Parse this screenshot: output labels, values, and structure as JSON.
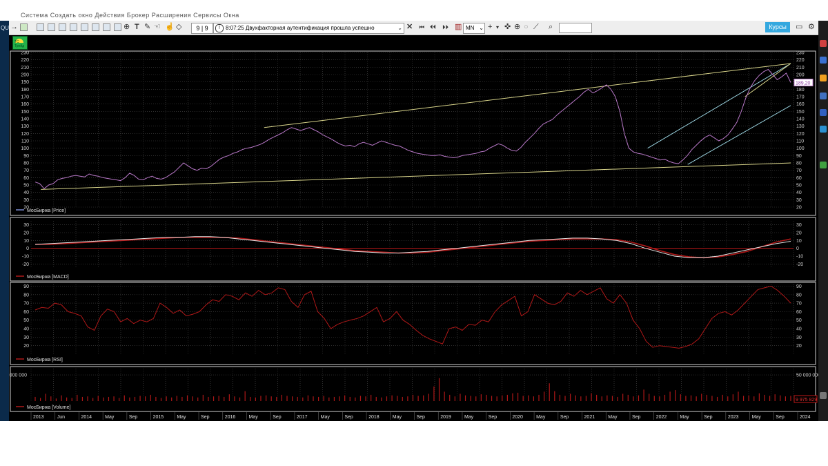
{
  "window": {
    "app_label": "QU",
    "menu_fragment": "Система   Создать окно   Действия   Брокер   Расширения   Сервисы   Окна"
  },
  "toolbar": {
    "counter": "9 | 9",
    "message": "8:07:25  Двухфакторная аутентификация прошла успешно",
    "period": "MN",
    "search_value": "",
    "kursy_label": "Курсы",
    "icons": [
      "arrow-right-icon",
      "chart-new-icon",
      "table-icon",
      "quotes-icon",
      "orders-icon",
      "deals-icon",
      "portfolio-icon",
      "positions-icon",
      "alerts-icon",
      "news-icon",
      "info-icon",
      "text-tool-icon",
      "pencil-icon",
      "hand-icon",
      "pointer-icon",
      "clear-icon",
      "close-icon",
      "first-icon",
      "prev-icon",
      "bars-icon",
      "plus-icon",
      "crosshair-icon",
      "target-icon",
      "ruler-icon",
      "magnifier-icon",
      "message-icon",
      "settings-icon"
    ]
  },
  "logo": {
    "text": "ТС Трейд"
  },
  "chart_data": [
    {
      "type": "line",
      "panel": "price",
      "legend": "МосБиржа [Price]",
      "last_value_label": "189,20",
      "ylim": [
        20,
        230
      ],
      "yticks": [
        20,
        30,
        40,
        50,
        60,
        70,
        80,
        90,
        100,
        110,
        120,
        130,
        140,
        150,
        160,
        170,
        180,
        190,
        200,
        210,
        220,
        230
      ],
      "x_start": "2013-02",
      "x_end": "2024-02",
      "color": "#b878c8",
      "series": [
        {
          "values": [
            54,
            52,
            45,
            50,
            52,
            57,
            59,
            60,
            62,
            63,
            62,
            61,
            65,
            63,
            62,
            60,
            59,
            58,
            57,
            56,
            60,
            66,
            63,
            58,
            57,
            60,
            62,
            59,
            58,
            60,
            64,
            68,
            74,
            80,
            76,
            72,
            70,
            73,
            72,
            75,
            80,
            85,
            88,
            90,
            93,
            95,
            98,
            100,
            101,
            103,
            105,
            108,
            112,
            115,
            118,
            121,
            125,
            128,
            126,
            124,
            126,
            128,
            125,
            122,
            118,
            115,
            112,
            108,
            105,
            103,
            104,
            102,
            106,
            108,
            106,
            104,
            107,
            110,
            108,
            106,
            104,
            103,
            100,
            97,
            95,
            93,
            92,
            91,
            90,
            90,
            91,
            89,
            88,
            87,
            88,
            90,
            91,
            92,
            93,
            95,
            96,
            100,
            103,
            106,
            104,
            100,
            97,
            96,
            101,
            108,
            114,
            120,
            127,
            133,
            136,
            139,
            145,
            150,
            155,
            160,
            165,
            170,
            176,
            180,
            175,
            178,
            182,
            186,
            180,
            170,
            150,
            120,
            100,
            95,
            93,
            92,
            90,
            88,
            86,
            84,
            85,
            82,
            80,
            79,
            84,
            90,
            98,
            104,
            110,
            115,
            118,
            114,
            110,
            113,
            118,
            126,
            135,
            150,
            168,
            182,
            192,
            199,
            204,
            207,
            200,
            193,
            197,
            202,
            189.2
          ]
        },
        {
          "name_hidden": true,
          "values": []
        }
      ],
      "trendlines": [
        {
          "color": "#d8d48a",
          "from": [
            "2013-03",
            44
          ],
          "to": [
            "2024-02",
            80
          ]
        },
        {
          "color": "#d8d48a",
          "from": [
            "2016-06",
            128
          ],
          "to": [
            "2024-02",
            215
          ]
        },
        {
          "color": "#9ad3e0",
          "from": [
            "2022-01",
            100
          ],
          "to": [
            "2024-02",
            215
          ]
        },
        {
          "color": "#9ad3e0",
          "from": [
            "2022-08",
            78
          ],
          "to": [
            "2024-02",
            158
          ]
        },
        {
          "color": "#d8d48a",
          "from": [
            "2023-06",
            170
          ],
          "to": [
            "2024-02",
            215
          ]
        }
      ]
    },
    {
      "type": "line",
      "panel": "macd",
      "legend": "МосБиржа [MACD]",
      "ylim": [
        -25,
        35
      ],
      "yticks": [
        -20,
        -10,
        0,
        10,
        20,
        30
      ],
      "series": [
        {
          "color": "#e6e6e6",
          "values": [
            5,
            6,
            7,
            8,
            9,
            10,
            11,
            12,
            13,
            14,
            14,
            15,
            15,
            14,
            12,
            10,
            8,
            6,
            4,
            2,
            0,
            -2,
            -4,
            -5,
            -6,
            -6,
            -5,
            -4,
            -2,
            0,
            2,
            4,
            6,
            8,
            10,
            11,
            12,
            13,
            13,
            12,
            10,
            6,
            0,
            -5,
            -10,
            -12,
            -12,
            -10,
            -6,
            -2,
            2,
            6,
            9
          ]
        },
        {
          "color": "#b01818",
          "values": [
            5,
            5,
            6,
            7,
            8,
            9,
            10,
            11,
            12,
            13,
            14,
            14,
            14,
            14,
            13,
            11,
            9,
            7,
            5,
            3,
            1,
            -1,
            -3,
            -4,
            -5,
            -6,
            -6,
            -5,
            -3,
            -1,
            1,
            3,
            5,
            7,
            9,
            10,
            11,
            12,
            12,
            12,
            11,
            8,
            3,
            -3,
            -8,
            -11,
            -12,
            -11,
            -8,
            -4,
            2,
            8,
            12
          ]
        }
      ],
      "zero_line_color": "#c01818"
    },
    {
      "type": "line",
      "panel": "rsi",
      "legend": "МосБиржа [RSI]",
      "ylim": [
        10,
        92
      ],
      "yticks": [
        20,
        30,
        40,
        50,
        60,
        70,
        80,
        90
      ],
      "color": "#b01818",
      "series": [
        {
          "values": [
            62,
            65,
            64,
            70,
            68,
            60,
            58,
            55,
            42,
            38,
            55,
            63,
            60,
            48,
            52,
            46,
            50,
            48,
            52,
            70,
            65,
            58,
            62,
            55,
            57,
            60,
            68,
            74,
            72,
            80,
            78,
            74,
            82,
            78,
            85,
            80,
            82,
            88,
            86,
            72,
            65,
            80,
            84,
            60,
            52,
            40,
            45,
            48,
            50,
            52,
            55,
            60,
            65,
            48,
            52,
            60,
            50,
            45,
            38,
            32,
            28,
            25,
            22,
            40,
            42,
            38,
            45,
            44,
            50,
            48,
            60,
            68,
            73,
            78,
            55,
            60,
            80,
            75,
            70,
            68,
            72,
            82,
            78,
            85,
            80,
            84,
            88,
            75,
            70,
            80,
            70,
            50,
            40,
            25,
            18,
            20,
            19,
            18,
            17,
            19,
            22,
            28,
            40,
            52,
            58,
            60,
            56,
            62,
            70,
            78,
            86,
            88,
            90,
            85,
            78,
            70
          ]
        }
      ]
    },
    {
      "type": "bar",
      "panel": "volume",
      "legend": "МосБиржа [Volume]",
      "ytick_label": "50 000 000",
      "last_value_label": "9 975 829",
      "color": "#b01818",
      "ylim": [
        0,
        62000000
      ],
      "values": [
        8,
        6,
        14,
        9,
        5,
        11,
        7,
        6,
        12,
        8,
        9,
        6,
        10,
        7,
        8,
        9,
        6,
        11,
        7,
        8,
        10,
        9,
        12,
        8,
        6,
        9,
        7,
        10,
        8,
        11,
        9,
        7,
        12,
        8,
        9,
        10,
        8,
        13,
        9,
        7,
        19,
        8,
        7,
        10,
        11,
        9,
        8,
        12,
        10,
        9,
        8,
        7,
        11,
        9,
        8,
        10,
        7,
        8,
        9,
        11,
        8,
        7,
        10,
        9,
        12,
        8,
        7,
        9,
        11,
        10,
        8,
        9,
        12,
        10,
        11,
        14,
        28,
        44,
        18,
        12,
        9,
        14,
        11,
        10,
        9,
        13,
        12,
        10,
        9,
        11,
        12,
        15,
        16,
        10,
        11,
        9,
        12,
        18,
        34,
        19,
        12,
        10,
        14,
        11,
        9,
        10,
        15,
        12,
        9,
        11,
        10,
        8,
        14,
        12,
        9,
        11,
        22,
        14,
        10,
        9,
        12,
        18,
        21,
        13,
        10,
        11,
        9,
        14,
        12,
        10,
        8,
        12,
        9,
        13,
        18,
        10,
        11,
        9,
        15,
        12,
        10,
        13,
        11,
        9,
        10
      ]
    }
  ],
  "x_axis": {
    "labels": [
      "2013",
      "Jun",
      "2014",
      "May",
      "Sep",
      "2015",
      "May",
      "Sep",
      "2016",
      "May",
      "Sep",
      "2017",
      "May",
      "Sep",
      "2018",
      "May",
      "Sep",
      "2019",
      "May",
      "Sep",
      "2020",
      "May",
      "Sep",
      "2021",
      "May",
      "Sep",
      "2022",
      "May",
      "Sep",
      "2023",
      "May",
      "Sep",
      "2024"
    ]
  },
  "colors": {
    "background": "#000000",
    "panel_border": "#cfcfcf",
    "grid": "#4a4a4a",
    "price_line": "#b878c8",
    "macd_signal": "#b01818",
    "macd_line": "#e6e6e6",
    "rsi_line": "#b01818",
    "volume_bar": "#b01818",
    "kursy_button": "#34a8df"
  }
}
